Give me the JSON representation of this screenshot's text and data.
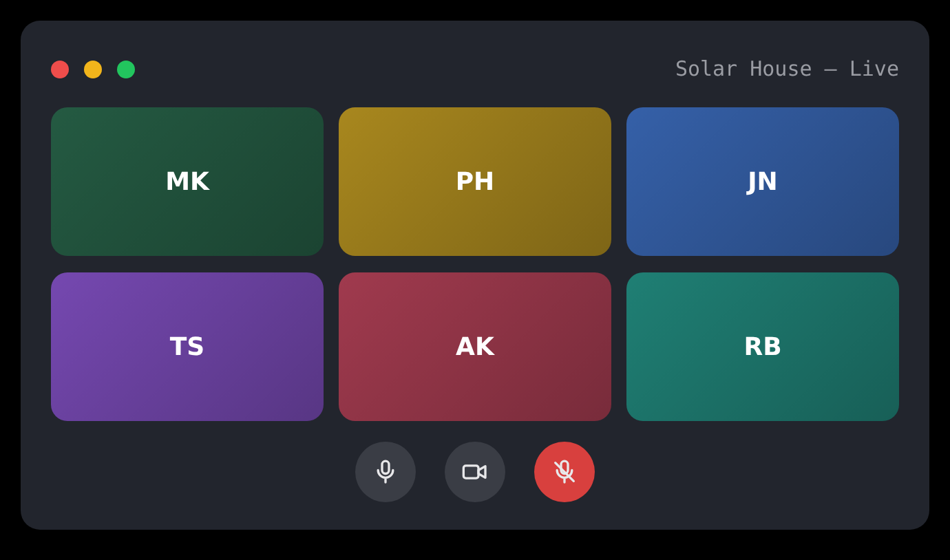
{
  "window": {
    "title": "Solar House – Live"
  },
  "tiles": [
    {
      "initials": "MK",
      "color": "#245a42"
    },
    {
      "initials": "PH",
      "color": "#a8871e"
    },
    {
      "initials": "JN",
      "color": "#3560a8"
    },
    {
      "initials": "TS",
      "color": "#7548b0"
    },
    {
      "initials": "AK",
      "color": "#a03a4e"
    },
    {
      "initials": "RB",
      "color": "#1f7f74"
    }
  ],
  "controls": [
    {
      "kind": "mic",
      "active": false
    },
    {
      "kind": "camera",
      "active": false
    },
    {
      "kind": "mic-off",
      "active": true
    }
  ]
}
